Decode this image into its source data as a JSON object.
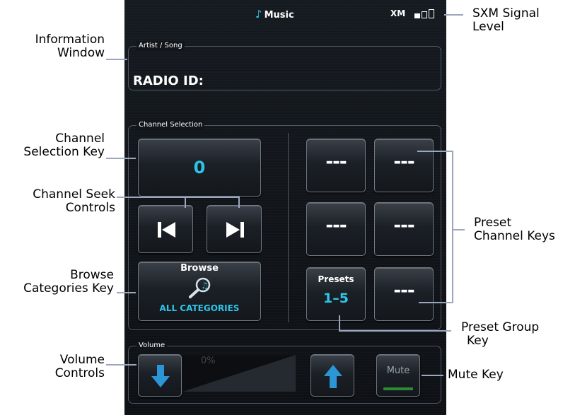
{
  "screen": {
    "title": "Music",
    "signal_label": "XM",
    "signal_bars_filled": 1,
    "signal_bars_total": 3
  },
  "info": {
    "legend": "Artist / Song",
    "text": "RADIO ID:"
  },
  "channel": {
    "legend": "Channel Selection",
    "number": "0",
    "browse_label": "Browse",
    "browse_category": "ALL CATEGORIES",
    "presets_label": "Presets",
    "presets_range": "1–5",
    "preset_empty": "---"
  },
  "volume": {
    "legend": "Volume",
    "percent": "0%",
    "level": 0,
    "mute_label": "Mute"
  },
  "callouts": {
    "information_window": [
      "Information",
      "Window"
    ],
    "channel_selection_key": [
      "Channel",
      "Selection Key"
    ],
    "channel_seek_controls": [
      "Channel Seek",
      "Controls"
    ],
    "browse_categories_key": [
      "Browse",
      "Categories Key"
    ],
    "volume_controls": [
      "Volume",
      "Controls"
    ],
    "sxm_signal_level": [
      "SXM Signal",
      "Level"
    ],
    "preset_channel_keys": [
      "Preset",
      "Channel Keys"
    ],
    "preset_group_key": [
      "Preset Group",
      "Key"
    ],
    "mute_key": "Mute Key"
  },
  "colors": {
    "accent": "#2ec4e8",
    "mute_active": "#2a8c36",
    "background": "#12161b"
  }
}
